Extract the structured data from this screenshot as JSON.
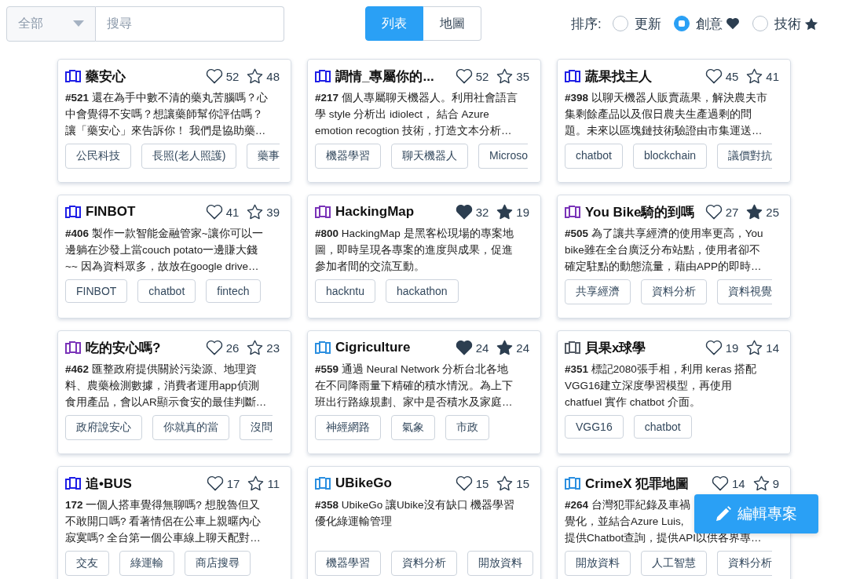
{
  "filter": {
    "category": "全部",
    "search_placeholder": "搜尋"
  },
  "view_toggle": [
    {
      "label": "列表",
      "selected": true
    },
    {
      "label": "地圖",
      "selected": false
    }
  ],
  "sort": {
    "label": "排序:",
    "options": [
      {
        "label": "更新",
        "kind": "plain",
        "selected": false
      },
      {
        "label": "創意",
        "kind": "heart",
        "selected": true
      },
      {
        "label": "技術",
        "kind": "star",
        "selected": false
      }
    ]
  },
  "projects": [
    {
      "title": "藥安心",
      "color": "#1f1fe6",
      "likes": "52",
      "liked": false,
      "stars_count": "48",
      "starred": false,
      "description": [
        "**#521** 還在為手中數不清的藥丸苦腦嗎？心",
        "中會覺得不安嗎？想讓藥師幫你評估嗎？",
        "讓「藥安心」來告訴你！ 我們是協助藥…"
      ],
      "tags": [
        {
          "label": "公民科技",
          "cut": false
        },
        {
          "label": "長照(老人照護)",
          "cut": false
        },
        {
          "label": "藥事",
          "cut": true
        }
      ]
    },
    {
      "title": "調情_專屬你的...",
      "color": "#1f1fe6",
      "likes": "52",
      "liked": false,
      "stars_count": "35",
      "starred": false,
      "description": [
        "**#217** 個人專屬聊天機器人。利用社會語言",
        "學 style 分析出 idiolect， 結合 Azure",
        "emotion recogtion 技術，打造文本分析…"
      ],
      "tags": [
        {
          "label": "機器學習",
          "cut": false
        },
        {
          "label": "聊天機器人",
          "cut": false
        },
        {
          "label": "Microso",
          "cut": true
        }
      ]
    },
    {
      "title": "蔬果找主人",
      "color": "#1f1fe6",
      "likes": "45",
      "liked": false,
      "stars_count": "41",
      "starred": false,
      "description": [
        "**#398** 以聊天機器人販賣蔬果，解決農夫市",
        "集剩餘產品以及假日農夫生產過剩的問",
        "題。未來以區塊鏈技術驗證由市集運送…"
      ],
      "tags": [
        {
          "label": "chatbot",
          "cut": false
        },
        {
          "label": "blockchain",
          "cut": false
        },
        {
          "label": "議價對抗",
          "cut": true
        }
      ]
    },
    {
      "title": "FINBOT",
      "color": "#1f1fe6",
      "likes": "41",
      "liked": false,
      "stars_count": "39",
      "starred": false,
      "description": [
        "**#406** 製作一款智能金融管家~讓你可以一",
        "邊躺在沙發上當couch potato一邊賺大錢",
        "~~ 因為資料眾多，故放在google drive…"
      ],
      "tags": [
        {
          "label": "FINBOT",
          "cut": false
        },
        {
          "label": "chatbot",
          "cut": false
        },
        {
          "label": "fintech",
          "cut": false
        }
      ]
    },
    {
      "title": "HackingMap",
      "color": "#7a33b8",
      "likes": "32",
      "liked": true,
      "stars_count": "19",
      "starred": true,
      "description": [
        "**#800** HackingMap 是黑客松現場的專案地",
        "圖，即時呈現各專案的進度與成果，促進",
        "參加者間的交流互動。"
      ],
      "tags": [
        {
          "label": "hackntu",
          "cut": false
        },
        {
          "label": "hackathon",
          "cut": false
        }
      ]
    },
    {
      "title": "You Bike騎的到嗎",
      "color": "#7a33b8",
      "likes": "27",
      "liked": false,
      "stars_count": "25",
      "starred": true,
      "description": [
        "**#505** 為了讓共享經濟的使用率更高，You",
        "bike雖在全台廣泛分布站點，使用者卻不",
        "確定駐點的動態流量，藉由APP的即時…"
      ],
      "tags": [
        {
          "label": "共享經濟",
          "cut": false
        },
        {
          "label": "資料分析",
          "cut": false
        },
        {
          "label": "資料視覺",
          "cut": true
        }
      ]
    },
    {
      "title": "吃的安心嗎?",
      "color": "#7a33b8",
      "likes": "26",
      "liked": false,
      "stars_count": "23",
      "starred": false,
      "description": [
        "**#462** 匯整政府提供關於污染源、地理資",
        "料、農藥檢測數據，消費者運用app偵測",
        "食用產品，會以AR顯示食安的最佳判斷…"
      ],
      "tags": [
        {
          "label": "政府說安心",
          "cut": false
        },
        {
          "label": "你就真的當",
          "cut": false
        },
        {
          "label": "沒問",
          "cut": true
        }
      ]
    },
    {
      "title": "Cigriculture",
      "color": "#2b8fe0",
      "likes": "24",
      "liked": true,
      "stars_count": "24",
      "starred": true,
      "description": [
        "**#559** 通過 Neural Network 分析台北各地",
        "在不同降雨量下精確的積水情況。為上下",
        "班出行路線規劃、家中是否積水及家庭…"
      ],
      "tags": [
        {
          "label": "神經網路",
          "cut": false
        },
        {
          "label": "氣象",
          "cut": false
        },
        {
          "label": "市政",
          "cut": false
        }
      ]
    },
    {
      "title": "貝果x球學",
      "color": "#555c66",
      "likes": "19",
      "liked": false,
      "stars_count": "14",
      "starred": false,
      "description": [
        "**#351** 標記2080張手相，利用 keras 搭配",
        "VGG16建立深度學習模型，再使用",
        "chatfuel 實作 chatbot 介面。"
      ],
      "tags": [
        {
          "label": "VGG16",
          "cut": false
        },
        {
          "label": "chatbot",
          "cut": false
        }
      ]
    },
    {
      "title": "追•BUS",
      "color": "#1f1fe6",
      "likes": "17",
      "liked": false,
      "stars_count": "11",
      "starred": false,
      "description": [
        "**172** 一個人搭車覺得無聊嗎? 想脫魯但又",
        "不敢開口嗎? 看著情侶在公車上親暱內心",
        "寂寞嗎? 全台第一個公車線上聊天配對…"
      ],
      "tags": [
        {
          "label": "交友",
          "cut": false
        },
        {
          "label": "綠運輸",
          "cut": false
        },
        {
          "label": "商店搜尋",
          "cut": false
        }
      ]
    },
    {
      "title": "UBikeGo",
      "color": "#2b8fe0",
      "likes": "15",
      "liked": false,
      "stars_count": "15",
      "starred": false,
      "description": [
        "**#358** UbikeGo 讓Ubike沒有缺口 機器學習",
        "優化綠運輸管理"
      ],
      "tags": [
        {
          "label": "機器學習",
          "cut": false
        },
        {
          "label": "資料分析",
          "cut": false
        },
        {
          "label": "開放資料",
          "cut": false
        }
      ]
    },
    {
      "title": "CrimeX 犯罪地圖",
      "color": "#2b8fe0",
      "likes": "14",
      "liked": false,
      "stars_count": "9",
      "starred": false,
      "description": [
        "**#264** 台灣犯罪紀錄及車禍",
        "覺化，並結合Azure Luis,",
        "提供Chatbot查詢，提供API以供各界專…"
      ],
      "tags": [
        {
          "label": "開放資料",
          "cut": false
        },
        {
          "label": "人工智慧",
          "cut": false
        },
        {
          "label": "資料分析",
          "cut": true
        }
      ]
    }
  ],
  "edit_button": "編輯專案"
}
